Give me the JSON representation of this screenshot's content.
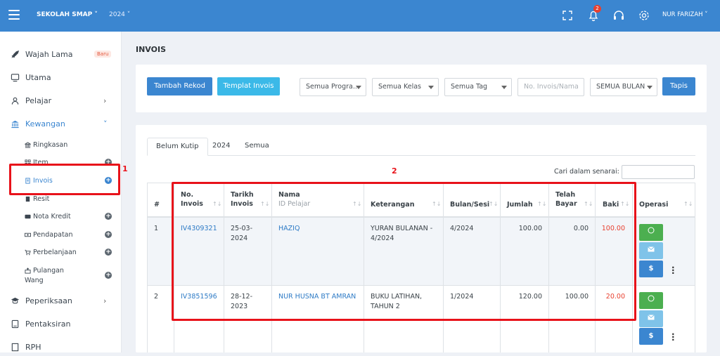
{
  "header": {
    "school": "SEKOLAH SMAP",
    "year": "2024",
    "user": "NUR FARIZAH",
    "notif_count": "2"
  },
  "sidebar": {
    "items": [
      {
        "label": "Wajah Lama",
        "badge": "Baru",
        "icon": "rocket-icon"
      },
      {
        "label": "Utama",
        "icon": "monitor-icon"
      },
      {
        "label": "Pelajar",
        "icon": "user-icon"
      },
      {
        "label": "Kewangan",
        "icon": "bank-icon"
      }
    ],
    "sub": [
      {
        "label": "Ringkasan"
      },
      {
        "label": "Item"
      },
      {
        "label": "Invois"
      },
      {
        "label": "Resit"
      },
      {
        "label": "Nota Kredit"
      },
      {
        "label": "Pendapatan"
      },
      {
        "label": "Perbelanjaan"
      },
      {
        "label": "Pulangan",
        "label2": "Wang"
      }
    ],
    "items2": [
      {
        "label": "Peperiksaan",
        "icon": "graduation-icon"
      },
      {
        "label": "Pentaksiran",
        "icon": "book-icon"
      },
      {
        "label": "RPH",
        "icon": "document-icon"
      }
    ]
  },
  "annotations": {
    "one": "1",
    "two": "2"
  },
  "page": {
    "title": "INVOIS"
  },
  "toolbar": {
    "add_label": "Tambah Rekod",
    "template_label": "Templat Invois",
    "program": "Semua Progra...",
    "class": "Semua Kelas",
    "tag": "Semua Tag",
    "search_placeholder": "No. Invois/Nama",
    "month": "SEMUA BULAN",
    "filter_label": "Tapis"
  },
  "tabs": [
    "Belum Kutip",
    "2024",
    "Semua"
  ],
  "table": {
    "search_label": "Cari dalam senarai:",
    "headers": {
      "num": "#",
      "invoice": [
        "No.",
        "Invois"
      ],
      "date": [
        "Tarikh",
        "Invois"
      ],
      "name": [
        "Nama",
        "ID Pelajar"
      ],
      "desc": "Keterangan",
      "month": "Bulan/Sesi",
      "amount": "Jumlah",
      "paid": [
        "Telah",
        "Bayar"
      ],
      "balance": "Baki",
      "ops": "Operasi"
    },
    "rows": [
      {
        "num": "1",
        "invoice": "IV4309321",
        "date": [
          "25-03-",
          "2024"
        ],
        "name": "HAZIQ",
        "desc": [
          "YURAN BULANAN -",
          "4/2024"
        ],
        "month": "4/2024",
        "amount": "100.00",
        "paid": "0.00",
        "balance": "100.00"
      },
      {
        "num": "2",
        "invoice": "IV3851596",
        "date": [
          "28-12-",
          "2023"
        ],
        "name": "NUR HUSNA BT AMRAN",
        "desc": [
          "BUKU LATIHAN,",
          "TAHUN 2"
        ],
        "month": "1/2024",
        "amount": "120.00",
        "paid": "100.00",
        "balance": "20.00"
      }
    ]
  },
  "colors": {
    "primary": "#3b86d0",
    "info": "#3bb9e8",
    "whatsapp": "#4caf50",
    "email": "#7fc3e9",
    "highlight": "#e8121a",
    "balance": "#e8402f"
  }
}
